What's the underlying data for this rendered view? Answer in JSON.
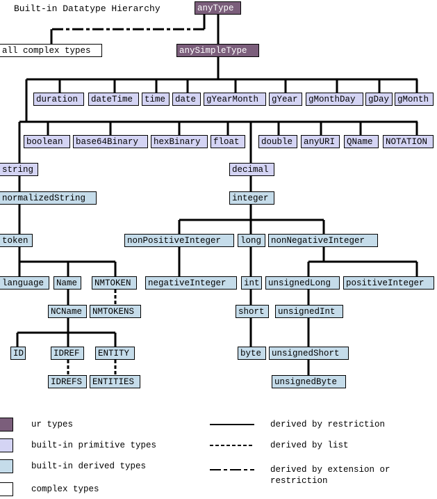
{
  "title": "Built-in Datatype Hierarchy",
  "colors": {
    "ur": "#7b5e7b",
    "primitive": "#d4d4f4",
    "derived": "#c5dcea",
    "complex": "#ffffff",
    "line": "#000000"
  },
  "nodes": {
    "anyType": {
      "label": "anyType",
      "kind": "ur"
    },
    "allComplexTypes": {
      "label": "all complex types",
      "kind": "complex"
    },
    "anySimpleType": {
      "label": "anySimpleType",
      "kind": "ur"
    },
    "duration": {
      "label": "duration",
      "kind": "primitive"
    },
    "dateTime": {
      "label": "dateTime",
      "kind": "primitive"
    },
    "time": {
      "label": "time",
      "kind": "primitive"
    },
    "date": {
      "label": "date",
      "kind": "primitive"
    },
    "gYearMonth": {
      "label": "gYearMonth",
      "kind": "primitive"
    },
    "gYear": {
      "label": "gYear",
      "kind": "primitive"
    },
    "gMonthDay": {
      "label": "gMonthDay",
      "kind": "primitive"
    },
    "gDay": {
      "label": "gDay",
      "kind": "primitive"
    },
    "gMonth": {
      "label": "gMonth",
      "kind": "primitive"
    },
    "boolean": {
      "label": "boolean",
      "kind": "primitive"
    },
    "base64Binary": {
      "label": "base64Binary",
      "kind": "primitive"
    },
    "hexBinary": {
      "label": "hexBinary",
      "kind": "primitive"
    },
    "float": {
      "label": "float",
      "kind": "primitive"
    },
    "double": {
      "label": "double",
      "kind": "primitive"
    },
    "anyURI": {
      "label": "anyURI",
      "kind": "primitive"
    },
    "QName": {
      "label": "QName",
      "kind": "primitive"
    },
    "NOTATION": {
      "label": "NOTATION",
      "kind": "primitive"
    },
    "string": {
      "label": "string",
      "kind": "primitive"
    },
    "decimal": {
      "label": "decimal",
      "kind": "primitive"
    },
    "normalizedString": {
      "label": "normalizedString",
      "kind": "derived"
    },
    "integer": {
      "label": "integer",
      "kind": "derived"
    },
    "token": {
      "label": "token",
      "kind": "derived"
    },
    "nonPositiveInteger": {
      "label": "nonPositiveInteger",
      "kind": "derived"
    },
    "long": {
      "label": "long",
      "kind": "derived"
    },
    "nonNegativeInteger": {
      "label": "nonNegativeInteger",
      "kind": "derived"
    },
    "language": {
      "label": "language",
      "kind": "derived"
    },
    "Name": {
      "label": "Name",
      "kind": "derived"
    },
    "NMTOKEN": {
      "label": "NMTOKEN",
      "kind": "derived"
    },
    "negativeInteger": {
      "label": "negativeInteger",
      "kind": "derived"
    },
    "int": {
      "label": "int",
      "kind": "derived"
    },
    "unsignedLong": {
      "label": "unsignedLong",
      "kind": "derived"
    },
    "positiveInteger": {
      "label": "positiveInteger",
      "kind": "derived"
    },
    "NCName": {
      "label": "NCName",
      "kind": "derived"
    },
    "NMTOKENS": {
      "label": "NMTOKENS",
      "kind": "derived"
    },
    "short": {
      "label": "short",
      "kind": "derived"
    },
    "unsignedInt": {
      "label": "unsignedInt",
      "kind": "derived"
    },
    "ID": {
      "label": "ID",
      "kind": "derived"
    },
    "IDREF": {
      "label": "IDREF",
      "kind": "derived"
    },
    "ENTITY": {
      "label": "ENTITY",
      "kind": "derived"
    },
    "byte": {
      "label": "byte",
      "kind": "derived"
    },
    "unsignedShort": {
      "label": "unsignedShort",
      "kind": "derived"
    },
    "IDREFS": {
      "label": "IDREFS",
      "kind": "derived"
    },
    "ENTITIES": {
      "label": "ENTITIES",
      "kind": "derived"
    },
    "unsignedByte": {
      "label": "unsignedByte",
      "kind": "derived"
    }
  },
  "edges": [
    {
      "from": "anyType",
      "to": "allComplexTypes",
      "type": "extension-or-restriction"
    },
    {
      "from": "anyType",
      "to": "anySimpleType",
      "type": "restriction"
    },
    {
      "from": "anySimpleType",
      "to": "duration",
      "type": "restriction"
    },
    {
      "from": "anySimpleType",
      "to": "dateTime",
      "type": "restriction"
    },
    {
      "from": "anySimpleType",
      "to": "time",
      "type": "restriction"
    },
    {
      "from": "anySimpleType",
      "to": "date",
      "type": "restriction"
    },
    {
      "from": "anySimpleType",
      "to": "gYearMonth",
      "type": "restriction"
    },
    {
      "from": "anySimpleType",
      "to": "gYear",
      "type": "restriction"
    },
    {
      "from": "anySimpleType",
      "to": "gMonthDay",
      "type": "restriction"
    },
    {
      "from": "anySimpleType",
      "to": "gDay",
      "type": "restriction"
    },
    {
      "from": "anySimpleType",
      "to": "gMonth",
      "type": "restriction"
    },
    {
      "from": "anySimpleType",
      "to": "boolean",
      "type": "restriction"
    },
    {
      "from": "anySimpleType",
      "to": "base64Binary",
      "type": "restriction"
    },
    {
      "from": "anySimpleType",
      "to": "hexBinary",
      "type": "restriction"
    },
    {
      "from": "anySimpleType",
      "to": "float",
      "type": "restriction"
    },
    {
      "from": "anySimpleType",
      "to": "double",
      "type": "restriction"
    },
    {
      "from": "anySimpleType",
      "to": "anyURI",
      "type": "restriction"
    },
    {
      "from": "anySimpleType",
      "to": "QName",
      "type": "restriction"
    },
    {
      "from": "anySimpleType",
      "to": "NOTATION",
      "type": "restriction"
    },
    {
      "from": "anySimpleType",
      "to": "string",
      "type": "restriction"
    },
    {
      "from": "anySimpleType",
      "to": "decimal",
      "type": "restriction"
    },
    {
      "from": "string",
      "to": "normalizedString",
      "type": "restriction"
    },
    {
      "from": "normalizedString",
      "to": "token",
      "type": "restriction"
    },
    {
      "from": "token",
      "to": "language",
      "type": "restriction"
    },
    {
      "from": "token",
      "to": "Name",
      "type": "restriction"
    },
    {
      "from": "token",
      "to": "NMTOKEN",
      "type": "restriction"
    },
    {
      "from": "Name",
      "to": "NCName",
      "type": "restriction"
    },
    {
      "from": "NMTOKEN",
      "to": "NMTOKENS",
      "type": "list"
    },
    {
      "from": "NCName",
      "to": "ID",
      "type": "restriction"
    },
    {
      "from": "NCName",
      "to": "IDREF",
      "type": "restriction"
    },
    {
      "from": "NCName",
      "to": "ENTITY",
      "type": "restriction"
    },
    {
      "from": "IDREF",
      "to": "IDREFS",
      "type": "list"
    },
    {
      "from": "ENTITY",
      "to": "ENTITIES",
      "type": "list"
    },
    {
      "from": "decimal",
      "to": "integer",
      "type": "restriction"
    },
    {
      "from": "integer",
      "to": "nonPositiveInteger",
      "type": "restriction"
    },
    {
      "from": "integer",
      "to": "long",
      "type": "restriction"
    },
    {
      "from": "integer",
      "to": "nonNegativeInteger",
      "type": "restriction"
    },
    {
      "from": "nonPositiveInteger",
      "to": "negativeInteger",
      "type": "restriction"
    },
    {
      "from": "long",
      "to": "int",
      "type": "restriction"
    },
    {
      "from": "int",
      "to": "short",
      "type": "restriction"
    },
    {
      "from": "short",
      "to": "byte",
      "type": "restriction"
    },
    {
      "from": "nonNegativeInteger",
      "to": "unsignedLong",
      "type": "restriction"
    },
    {
      "from": "nonNegativeInteger",
      "to": "positiveInteger",
      "type": "restriction"
    },
    {
      "from": "unsignedLong",
      "to": "unsignedInt",
      "type": "restriction"
    },
    {
      "from": "unsignedInt",
      "to": "unsignedShort",
      "type": "restriction"
    },
    {
      "from": "unsignedShort",
      "to": "unsignedByte",
      "type": "restriction"
    }
  ],
  "legend": {
    "swatches": [
      {
        "label": "ur types",
        "kind": "ur"
      },
      {
        "label": "built-in primitive types",
        "kind": "primitive"
      },
      {
        "label": "built-in derived types",
        "kind": "derived"
      },
      {
        "label": "complex types",
        "kind": "complex"
      }
    ],
    "lines": [
      {
        "label": "derived by restriction",
        "type": "restriction"
      },
      {
        "label": "derived by list",
        "type": "list"
      },
      {
        "label": "derived by extension or restriction",
        "type": "extension-or-restriction"
      }
    ]
  }
}
